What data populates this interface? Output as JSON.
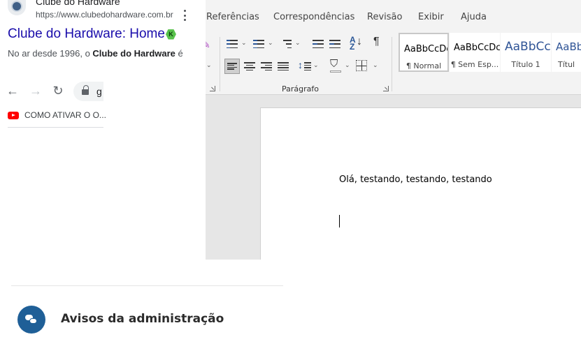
{
  "search_result": {
    "site_name": "Clube do Hardware",
    "url": "https://www.clubedohardware.com.br",
    "title": "Clube do Hardware: Home",
    "badge": "K",
    "snippet_prefix": "No ar desde 1996, o ",
    "snippet_bold": "Clube do Hardware",
    "snippet_suffix": " é"
  },
  "browser": {
    "omnibox_text": "g",
    "bookmark_label": "COMO ATIVAR O O..."
  },
  "word": {
    "tabs": [
      "Referências",
      "Correspondências",
      "Revisão",
      "Exibir",
      "Ajuda"
    ],
    "group_paragraph": "Parágrafo",
    "pilcrow": "¶",
    "styles": [
      {
        "sample": "AaBbCcDc",
        "name": "¶ Normal"
      },
      {
        "sample": "AaBbCcDc",
        "name": "¶ Sem Esp..."
      },
      {
        "sample": "AaBbCc",
        "name": "Título 1"
      },
      {
        "sample": "AaBb",
        "name": "Títul"
      }
    ],
    "heading_color": "#2f5496",
    "document_text": "Olá, testando, testando, testando"
  },
  "forum": {
    "section_title": "Avisos da administração",
    "icon_color": "#1f5f97"
  }
}
